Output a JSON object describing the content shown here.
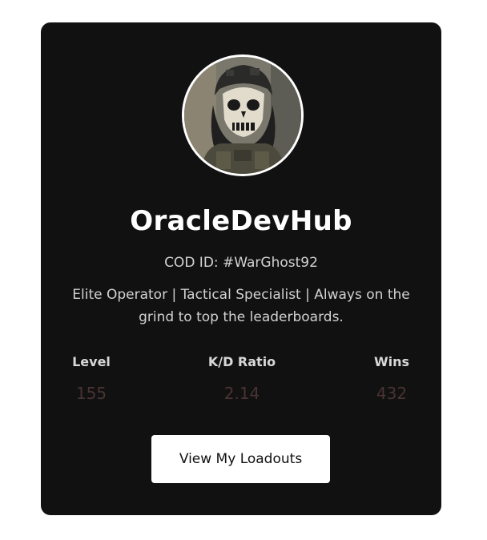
{
  "profile": {
    "username": "OracleDevHub",
    "cod_id": "COD ID: #WarGhost92",
    "bio": "Elite Operator | Tactical Specialist | Always on the grind to top the leaderboards.",
    "avatar_icon": "skull-mask-soldier-avatar"
  },
  "stats": [
    {
      "label": "Level",
      "value": "155"
    },
    {
      "label": "K/D Ratio",
      "value": "2.14"
    },
    {
      "label": "Wins",
      "value": "432"
    }
  ],
  "actions": {
    "loadouts_label": "View My Loadouts"
  },
  "colors": {
    "card_background": "#111111",
    "stat_value": "#4a3333",
    "button_background": "#ffffff"
  }
}
